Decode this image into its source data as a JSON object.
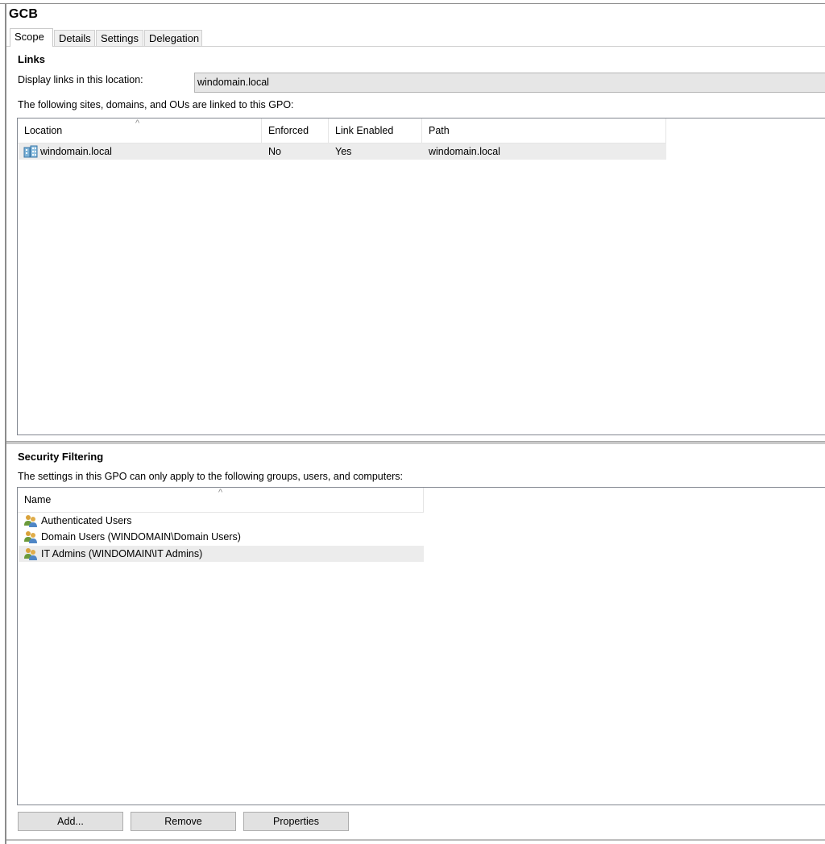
{
  "window": {
    "title": "GCB"
  },
  "tabs": [
    {
      "label": "Scope",
      "active": true
    },
    {
      "label": "Details",
      "active": false
    },
    {
      "label": "Settings",
      "active": false
    },
    {
      "label": "Delegation",
      "active": false
    }
  ],
  "links": {
    "title": "Links",
    "location_label": "Display links in this location:",
    "location_value": "windomain.local",
    "description": "The following sites, domains, and OUs are linked to this GPO:",
    "columns": [
      "Location",
      "Enforced",
      "Link Enabled",
      "Path"
    ],
    "sorted_column": "Location",
    "rows": [
      {
        "icon": "domain-icon",
        "location": "windomain.local",
        "enforced": "No",
        "link_enabled": "Yes",
        "path": "windomain.local",
        "selected": true
      }
    ]
  },
  "security_filtering": {
    "title": "Security Filtering",
    "description": "The settings in this GPO can only apply to the following groups, users, and computers:",
    "columns": [
      "Name"
    ],
    "sorted_column": "Name",
    "rows": [
      {
        "icon": "user-group-icon",
        "name": "Authenticated Users",
        "selected": false
      },
      {
        "icon": "user-group-icon",
        "name": "Domain Users (WINDOMAIN\\Domain Users)",
        "selected": false
      },
      {
        "icon": "user-group-icon",
        "name": "IT Admins (WINDOMAIN\\IT Admins)",
        "selected": true
      }
    ],
    "buttons": {
      "add": "Add...",
      "remove": "Remove",
      "properties": "Properties"
    }
  }
}
